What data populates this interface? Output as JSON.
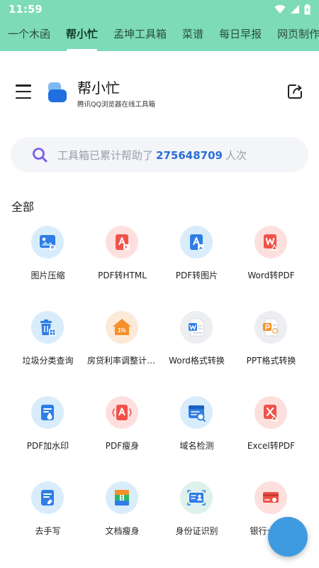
{
  "status_bar": {
    "time": "11:59"
  },
  "tabs": [
    {
      "label": "一个木函",
      "active": false
    },
    {
      "label": "帮小忙",
      "active": true
    },
    {
      "label": "孟坤工具箱",
      "active": false
    },
    {
      "label": "菜谱",
      "active": false
    },
    {
      "label": "每日早报",
      "active": false
    },
    {
      "label": "网页制作",
      "active": false
    }
  ],
  "header": {
    "title": "帮小忙",
    "subtitle": "腾讯QQ浏览器在线工具箱"
  },
  "search": {
    "prefix": "工具箱已累计帮助了",
    "count": "275648709",
    "suffix": "人次"
  },
  "section": {
    "title": "全部"
  },
  "tools": [
    {
      "label": "图片压缩",
      "icon": "image-compress-icon"
    },
    {
      "label": "PDF转HTML",
      "icon": "pdf-to-html-icon"
    },
    {
      "label": "PDF转图片",
      "icon": "pdf-to-image-icon"
    },
    {
      "label": "Word转PDF",
      "icon": "word-to-pdf-icon"
    },
    {
      "label": "垃圾分类查询",
      "icon": "trash-sort-icon"
    },
    {
      "label": "房贷利率调整计算器",
      "icon": "mortgage-rate-icon"
    },
    {
      "label": "Word格式转换",
      "icon": "word-format-icon"
    },
    {
      "label": "PPT格式转换",
      "icon": "ppt-format-icon"
    },
    {
      "label": "PDF加水印",
      "icon": "pdf-watermark-icon"
    },
    {
      "label": "PDF瘦身",
      "icon": "pdf-slim-icon"
    },
    {
      "label": "域名检测",
      "icon": "domain-check-icon"
    },
    {
      "label": "Excel转PDF",
      "icon": "excel-to-pdf-icon"
    },
    {
      "label": "去手写",
      "icon": "remove-handwriting-icon"
    },
    {
      "label": "文档瘦身",
      "icon": "doc-slim-icon"
    },
    {
      "label": "身份证识别",
      "icon": "id-card-ocr-icon"
    },
    {
      "label": "银行卡识别",
      "icon": "bank-card-ocr-icon"
    }
  ],
  "colors": {
    "accent": "#7ddbb8",
    "link_number": "#2a6fd6",
    "fab": "#3f9be0"
  }
}
